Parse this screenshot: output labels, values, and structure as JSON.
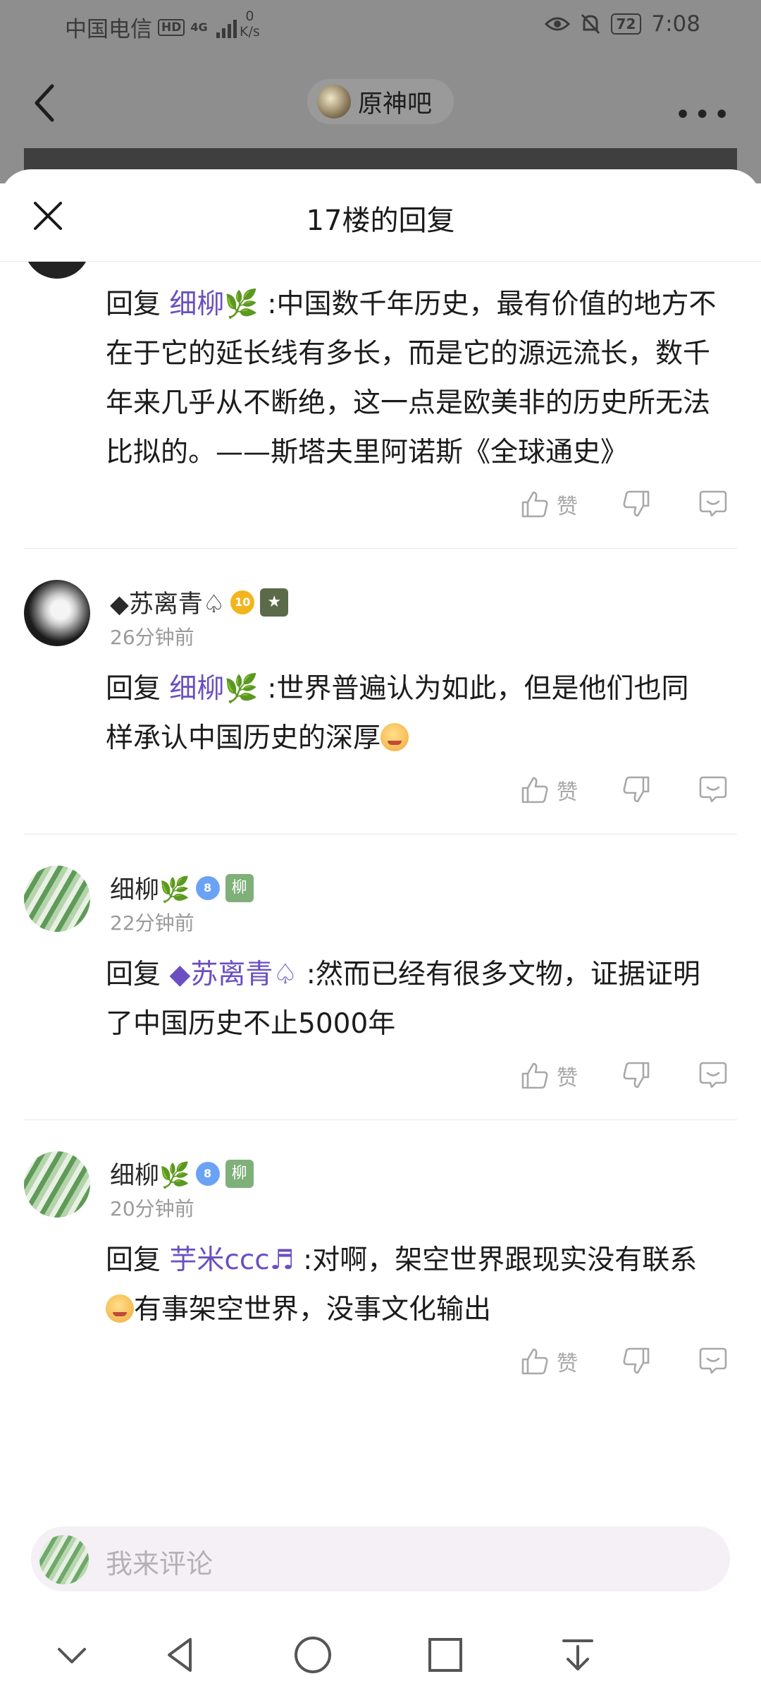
{
  "status_bar": {
    "carrier": "中国电信",
    "hd": "HD",
    "network": "4G",
    "speed_value": "0",
    "speed_unit": "K/s",
    "battery": "72",
    "time": "7:08"
  },
  "nav": {
    "title": "原神吧",
    "more": "•••"
  },
  "sheet": {
    "title": "17楼的回复"
  },
  "replies": [
    {
      "prefix": "回复",
      "mention": "细柳🌿",
      "text": ":中国数千年历史，最有价值的地方不在于它的延长线有多长，而是它的源远流长，数千年来几乎从不断绝，这一点是欧美非的历史所无法比拟的。——斯塔夫里阿诺斯《全球通史》",
      "like_label": "赞"
    },
    {
      "name": "◆苏离青♤",
      "level": "10",
      "time": "26分钟前",
      "prefix": "回复",
      "mention": "细柳🌿",
      "text": ":世界普遍认为如此，但是他们也同样承认中国历史的深厚",
      "like_label": "赞"
    },
    {
      "name": "细柳🌿",
      "level": "8",
      "badge": "柳",
      "time": "22分钟前",
      "prefix": "回复",
      "mention": "◆苏离青♤",
      "text": ":然而已经有很多文物，证据证明了中国历史不止5000年",
      "like_label": "赞"
    },
    {
      "name": "细柳🌿",
      "level": "8",
      "badge": "柳",
      "time": "20分钟前",
      "prefix": "回复",
      "mention": "芋米ccc♬",
      "text_a": ":对啊，架空世界跟现实没有联系",
      "text_b": "有事架空世界，没事文化输出",
      "like_label": "赞"
    }
  ],
  "comment_input": {
    "placeholder": "我来评论"
  },
  "colors": {
    "mention": "#6a4fc1",
    "action_gray": "#a8a8a8",
    "overlay": "#8e8e8e"
  }
}
